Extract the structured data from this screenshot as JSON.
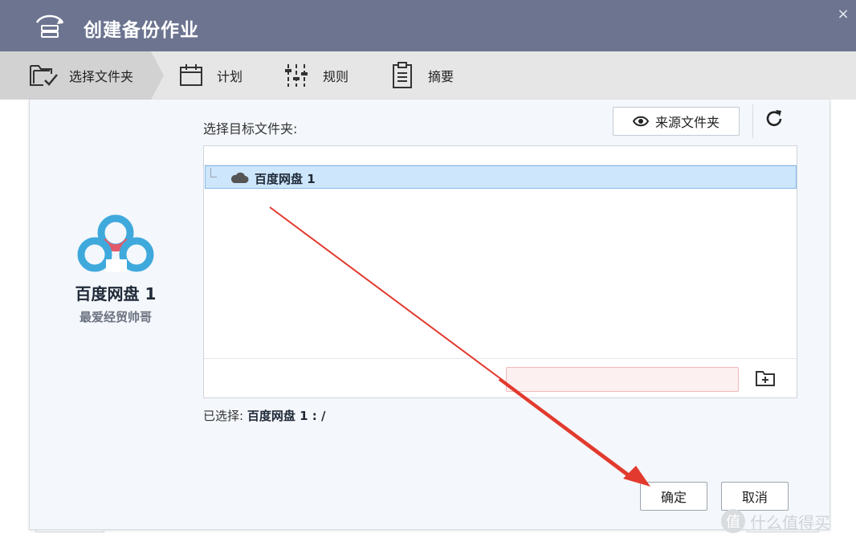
{
  "window": {
    "title": "创建备份作业",
    "close_glyph": "×"
  },
  "steps": [
    {
      "label": "选择文件夹",
      "icon": "folder-check-icon",
      "active": true
    },
    {
      "label": "计划",
      "icon": "calendar-icon",
      "active": false
    },
    {
      "label": "规则",
      "icon": "sliders-icon",
      "active": false
    },
    {
      "label": "摘要",
      "icon": "clipboard-icon",
      "active": false
    }
  ],
  "account": {
    "name": "百度网盘 1",
    "subtitle": "最爱经贸帅哥",
    "logo": "baidu-netdisk-logo",
    "colors": {
      "blue": "#3fa9dc",
      "red": "#e25b6b"
    }
  },
  "destination": {
    "label": "选择目标文件夹:",
    "source_button": "来源文件夹",
    "tree_root": "百度网盘 1",
    "new_folder_value": "",
    "selected_prefix": "已选择:",
    "selected_value": "百度网盘 1 : /"
  },
  "actions": {
    "ok": "确定",
    "cancel": "取消"
  },
  "watermark": {
    "glyph": "值",
    "text": "什么值得买"
  },
  "colors": {
    "titlebar": "#6c7490",
    "selection": "#cde6fb",
    "annotation_arrow": "#e23a2e"
  }
}
